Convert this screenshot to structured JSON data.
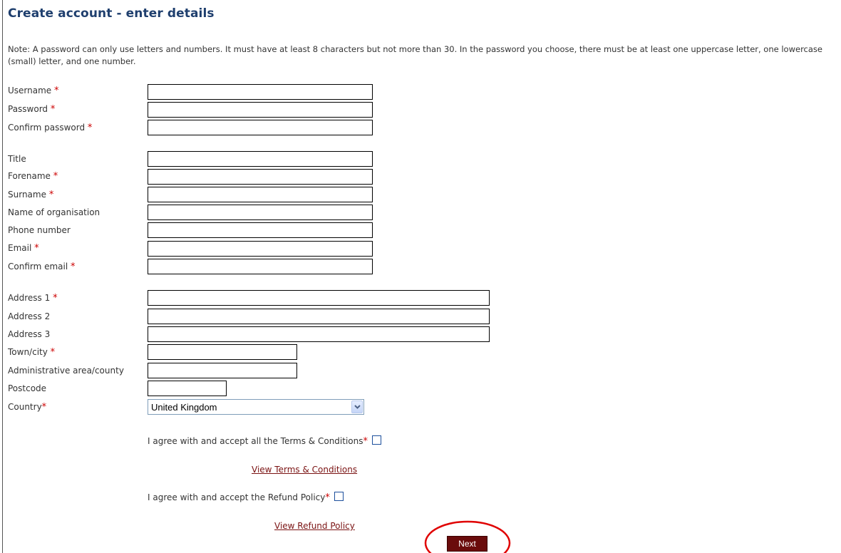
{
  "page": {
    "title": "Create account - enter details",
    "note": "Note: A password can only use letters and numbers. It must have at least 8 characters but not more than 30. In the password you choose, there must be at least one uppercase letter, one lowercase (small) letter, and one number."
  },
  "labels": {
    "username": "Username",
    "password": "Password",
    "confirm_password": "Confirm password",
    "title": "Title",
    "forename": "Forename",
    "surname": "Surname",
    "organisation": "Name of organisation",
    "phone": "Phone number",
    "email": "Email",
    "confirm_email": "Confirm email",
    "address1": "Address 1",
    "address2": "Address 2",
    "address3": "Address 3",
    "town": "Town/city",
    "county": "Administrative area/county",
    "postcode": "Postcode",
    "country": "Country",
    "required_marker": "*"
  },
  "fields": {
    "username": "",
    "password": "",
    "confirm_password": "",
    "title": "",
    "forename": "",
    "surname": "",
    "organisation": "",
    "phone": "",
    "email": "",
    "confirm_email": "",
    "address1": "",
    "address2": "",
    "address3": "",
    "town": "",
    "county": "",
    "postcode": ""
  },
  "country_select": {
    "selected": "United Kingdom",
    "arrow_icon": "chevron-down-icon"
  },
  "agreements": {
    "terms_text": "I agree with and accept all the Terms & Conditions",
    "terms_link": "View Terms & Conditions",
    "terms_checked": false,
    "refund_text": "I agree with and accept the Refund Policy",
    "refund_link": "View Refund Policy",
    "refund_checked": false
  },
  "actions": {
    "next_label": "Next"
  },
  "colors": {
    "title": "#1f3f6e",
    "required": "#cc0000",
    "link": "#7a1212",
    "button_bg": "#6a0c0c",
    "highlight": "#e00000"
  }
}
